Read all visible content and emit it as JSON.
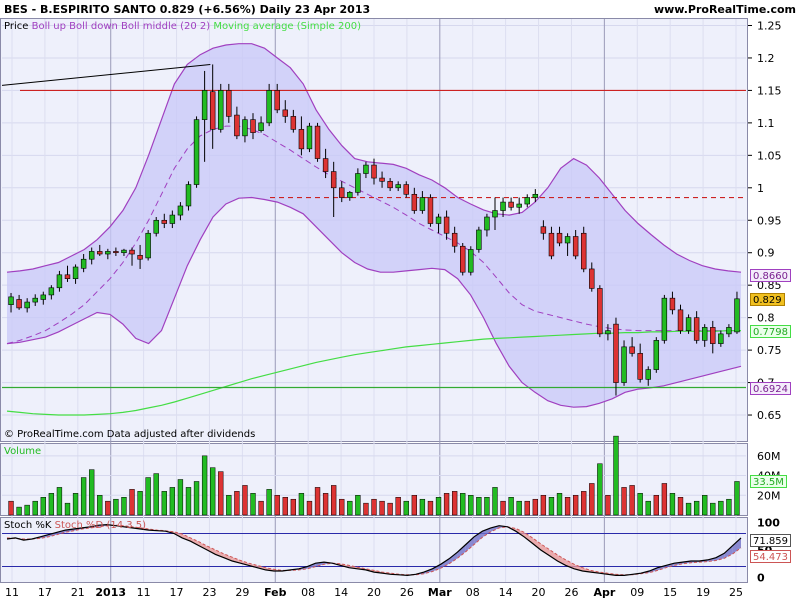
{
  "header": {
    "symbol_line": "BES - B.ESPIRITO SANTO    0.829 (+6.56%)    Daily  23 Apr 2013",
    "site": "www.ProRealTime.com"
  },
  "legends": {
    "price_prefix": "Price",
    "boll": "Boll up Boll down Boll middle (20 2)",
    "ma": "Moving average (Simple 200)",
    "copyright": "© ProRealTime.com  Data adjusted after dividends",
    "volume": "Volume",
    "stoch_k": "Stoch %K",
    "stoch_d": "Stoch %D (14 3 5)"
  },
  "colors": {
    "up": "#22bb22",
    "down": "#dd3333",
    "band_fill": "#c8c8f8",
    "band_line": "#a040c0",
    "ma200": "#44dd44",
    "resistance": "#cc2222",
    "support": "#33aa33"
  },
  "chart_data": [
    {
      "type": "candlestick",
      "title": "BES - B.ESPIRITO SANTO",
      "ylim": [
        0.61,
        1.26
      ],
      "y_ticks": [
        "0.65",
        "0.7",
        "0.75",
        "0.8",
        "0.85",
        "0.9",
        "0.95",
        "1",
        "1.05",
        "1.1",
        "1.15",
        "1.2",
        "1.25"
      ],
      "x_tick_labels": [
        "11",
        "17",
        "21",
        "2013",
        "11",
        "17",
        "23",
        "29",
        "Feb",
        "08",
        "14",
        "20",
        "26",
        "Mar",
        "08",
        "14",
        "20",
        "26",
        "Apr",
        "09",
        "15",
        "19",
        "25"
      ],
      "ohlc": [
        [
          0.82,
          0.838,
          0.808,
          0.832
        ],
        [
          0.828,
          0.835,
          0.812,
          0.815
        ],
        [
          0.815,
          0.83,
          0.808,
          0.824
        ],
        [
          0.824,
          0.836,
          0.818,
          0.83
        ],
        [
          0.828,
          0.84,
          0.82,
          0.835
        ],
        [
          0.835,
          0.85,
          0.828,
          0.846
        ],
        [
          0.846,
          0.872,
          0.84,
          0.866
        ],
        [
          0.866,
          0.88,
          0.855,
          0.86
        ],
        [
          0.86,
          0.882,
          0.852,
          0.878
        ],
        [
          0.876,
          0.898,
          0.87,
          0.89
        ],
        [
          0.89,
          0.908,
          0.882,
          0.902
        ],
        [
          0.902,
          0.912,
          0.895,
          0.898
        ],
        [
          0.898,
          0.906,
          0.89,
          0.902
        ],
        [
          0.902,
          0.908,
          0.895,
          0.9
        ],
        [
          0.9,
          0.906,
          0.895,
          0.904
        ],
        [
          0.904,
          0.908,
          0.88,
          0.898
        ],
        [
          0.896,
          0.912,
          0.875,
          0.89
        ],
        [
          0.892,
          0.935,
          0.888,
          0.93
        ],
        [
          0.93,
          0.955,
          0.925,
          0.95
        ],
        [
          0.95,
          0.96,
          0.938,
          0.945
        ],
        [
          0.945,
          0.965,
          0.938,
          0.958
        ],
        [
          0.958,
          0.978,
          0.95,
          0.972
        ],
        [
          0.972,
          1.01,
          0.965,
          1.005
        ],
        [
          1.005,
          1.11,
          1.0,
          1.105
        ],
        [
          1.105,
          1.18,
          1.04,
          1.15
        ],
        [
          1.148,
          1.19,
          1.06,
          1.09
        ],
        [
          1.09,
          1.16,
          1.085,
          1.15
        ],
        [
          1.15,
          1.16,
          1.1,
          1.11
        ],
        [
          1.112,
          1.125,
          1.075,
          1.08
        ],
        [
          1.08,
          1.11,
          1.07,
          1.105
        ],
        [
          1.105,
          1.115,
          1.075,
          1.085
        ],
        [
          1.088,
          1.11,
          1.085,
          1.1
        ],
        [
          1.1,
          1.16,
          1.095,
          1.15
        ],
        [
          1.15,
          1.16,
          1.115,
          1.12
        ],
        [
          1.12,
          1.135,
          1.1,
          1.11
        ],
        [
          1.11,
          1.12,
          1.085,
          1.09
        ],
        [
          1.09,
          1.11,
          1.05,
          1.06
        ],
        [
          1.06,
          1.1,
          1.055,
          1.095
        ],
        [
          1.095,
          1.1,
          1.04,
          1.045
        ],
        [
          1.045,
          1.06,
          1.015,
          1.025
        ],
        [
          1.025,
          1.04,
          0.955,
          1.0
        ],
        [
          1.0,
          1.01,
          0.978,
          0.985
        ],
        [
          0.985,
          0.995,
          0.98,
          0.993
        ],
        [
          0.993,
          1.03,
          0.988,
          1.022
        ],
        [
          1.022,
          1.04,
          1.015,
          1.035
        ],
        [
          1.035,
          1.045,
          1.005,
          1.015
        ],
        [
          1.015,
          1.025,
          1.0,
          1.01
        ],
        [
          1.01,
          1.015,
          0.995,
          1.0
        ],
        [
          1.0,
          1.01,
          0.995,
          1.005
        ],
        [
          1.005,
          1.01,
          0.985,
          0.99
        ],
        [
          0.99,
          1.0,
          0.96,
          0.965
        ],
        [
          0.965,
          0.995,
          0.96,
          0.985
        ],
        [
          0.985,
          0.99,
          0.94,
          0.945
        ],
        [
          0.945,
          0.96,
          0.93,
          0.955
        ],
        [
          0.955,
          0.965,
          0.92,
          0.93
        ],
        [
          0.93,
          0.94,
          0.9,
          0.91
        ],
        [
          0.91,
          0.915,
          0.865,
          0.87
        ],
        [
          0.87,
          0.91,
          0.865,
          0.905
        ],
        [
          0.905,
          0.94,
          0.9,
          0.935
        ],
        [
          0.935,
          0.96,
          0.925,
          0.955
        ],
        [
          0.955,
          0.985,
          0.935,
          0.965
        ],
        [
          0.965,
          0.985,
          0.955,
          0.978
        ],
        [
          0.978,
          0.985,
          0.965,
          0.97
        ],
        [
          0.97,
          0.985,
          0.96,
          0.975
        ],
        [
          0.975,
          0.99,
          0.97,
          0.985
        ],
        [
          0.985,
          0.998,
          0.978,
          0.99
        ],
        [
          0.94,
          0.95,
          0.92,
          0.93
        ],
        [
          0.93,
          0.94,
          0.89,
          0.895
        ],
        [
          0.93,
          0.94,
          0.91,
          0.915
        ],
        [
          0.915,
          0.93,
          0.895,
          0.925
        ],
        [
          0.925,
          0.935,
          0.89,
          0.895
        ],
        [
          0.93,
          0.94,
          0.87,
          0.875
        ],
        [
          0.875,
          0.885,
          0.84,
          0.845
        ],
        [
          0.845,
          0.85,
          0.77,
          0.775
        ],
        [
          0.775,
          0.79,
          0.765,
          0.78
        ],
        [
          0.79,
          0.8,
          0.68,
          0.7
        ],
        [
          0.7,
          0.765,
          0.695,
          0.755
        ],
        [
          0.755,
          0.77,
          0.74,
          0.745
        ],
        [
          0.745,
          0.76,
          0.7,
          0.705
        ],
        [
          0.705,
          0.725,
          0.695,
          0.72
        ],
        [
          0.72,
          0.77,
          0.715,
          0.765
        ],
        [
          0.765,
          0.835,
          0.76,
          0.83
        ],
        [
          0.83,
          0.84,
          0.805,
          0.812
        ],
        [
          0.812,
          0.82,
          0.775,
          0.78
        ],
        [
          0.78,
          0.805,
          0.775,
          0.8
        ],
        [
          0.8,
          0.81,
          0.76,
          0.765
        ],
        [
          0.765,
          0.79,
          0.755,
          0.785
        ],
        [
          0.785,
          0.795,
          0.745,
          0.76
        ],
        [
          0.76,
          0.78,
          0.755,
          0.775
        ],
        [
          0.775,
          0.79,
          0.77,
          0.785
        ],
        [
          0.778,
          0.84,
          0.775,
          0.829
        ]
      ],
      "bollinger_upper": [
        0.87,
        0.872,
        0.875,
        0.88,
        0.885,
        0.895,
        0.905,
        0.92,
        0.94,
        0.965,
        1.0,
        1.05,
        1.105,
        1.16,
        1.19,
        1.205,
        1.215,
        1.22,
        1.222,
        1.222,
        1.215,
        1.2,
        1.185,
        1.16,
        1.12,
        1.09,
        1.065,
        1.045,
        1.04,
        1.038,
        1.036,
        1.03,
        1.02,
        1.012,
        1.0,
        0.985,
        0.975,
        0.966,
        0.96,
        0.958,
        0.962,
        0.978,
        1.0,
        1.03,
        1.045,
        1.035,
        1.015,
        0.99,
        0.965,
        0.945,
        0.928,
        0.912,
        0.898,
        0.888,
        0.88,
        0.875,
        0.872,
        0.87
      ],
      "bollinger_lower": [
        0.76,
        0.762,
        0.766,
        0.77,
        0.778,
        0.788,
        0.798,
        0.808,
        0.805,
        0.79,
        0.768,
        0.76,
        0.78,
        0.83,
        0.88,
        0.92,
        0.955,
        0.975,
        0.984,
        0.985,
        0.982,
        0.978,
        0.97,
        0.96,
        0.94,
        0.92,
        0.9,
        0.885,
        0.875,
        0.87,
        0.87,
        0.872,
        0.874,
        0.876,
        0.874,
        0.86,
        0.835,
        0.8,
        0.76,
        0.725,
        0.7,
        0.685,
        0.672,
        0.665,
        0.662,
        0.663,
        0.668,
        0.675,
        0.685,
        0.69,
        0.692,
        0.695,
        0.7,
        0.705,
        0.71,
        0.715,
        0.72,
        0.725
      ],
      "bollinger_middle": [
        0.76,
        0.765,
        0.772,
        0.78,
        0.792,
        0.805,
        0.82,
        0.84,
        0.86,
        0.885,
        0.915,
        0.95,
        0.99,
        1.03,
        1.06,
        1.08,
        1.09,
        1.095,
        1.095,
        1.09,
        1.082,
        1.07,
        1.058,
        1.045,
        1.032,
        1.02,
        1.01,
        1.0,
        0.99,
        0.98,
        0.97,
        0.958,
        0.945,
        0.935,
        0.925,
        0.915,
        0.902,
        0.885,
        0.862,
        0.838,
        0.82,
        0.81,
        0.805,
        0.8,
        0.795,
        0.79,
        0.786,
        0.783,
        0.781,
        0.78,
        0.78,
        0.78,
        0.78,
        0.78,
        0.78,
        0.78,
        0.78,
        0.78
      ],
      "ma200": [
        0.656,
        0.654,
        0.652,
        0.651,
        0.65,
        0.65,
        0.65,
        0.651,
        0.652,
        0.654,
        0.657,
        0.661,
        0.665,
        0.67,
        0.676,
        0.682,
        0.688,
        0.694,
        0.7,
        0.706,
        0.711,
        0.716,
        0.721,
        0.726,
        0.731,
        0.735,
        0.739,
        0.743,
        0.746,
        0.749,
        0.752,
        0.755,
        0.757,
        0.759,
        0.761,
        0.763,
        0.765,
        0.767,
        0.768,
        0.769,
        0.77,
        0.771,
        0.772,
        0.773,
        0.774,
        0.775,
        0.776,
        0.776,
        0.777,
        0.777,
        0.778,
        0.778,
        0.779,
        0.779,
        0.779,
        0.779,
        0.78,
        0.78
      ],
      "hlines": [
        {
          "value": 1.15,
          "style": "solid",
          "color": "#cc2222"
        },
        {
          "value": 0.985,
          "style": "dashed",
          "color": "#cc2222"
        },
        {
          "value": 0.6924,
          "style": "solid",
          "color": "#33aa33"
        }
      ],
      "trendline": {
        "from": [
          0.0,
          1.17
        ],
        "to": [
          0.28,
          1.19
        ]
      },
      "value_tags": [
        {
          "value": 0.866,
          "label": "0.8660",
          "kind": "band"
        },
        {
          "value": 0.829,
          "label": "0.829",
          "kind": "price"
        },
        {
          "value": 0.7798,
          "label": "0.7798",
          "kind": "ma"
        },
        {
          "value": 0.6924,
          "label": "0.6924",
          "kind": "band"
        }
      ]
    },
    {
      "type": "bar",
      "title": "Volume",
      "ylim": [
        0,
        72
      ],
      "y_ticks": [
        "60M",
        "40M",
        "20M"
      ],
      "values": [
        14,
        8,
        10,
        14,
        18,
        22,
        28,
        12,
        22,
        38,
        46,
        20,
        14,
        16,
        18,
        26,
        24,
        38,
        42,
        24,
        28,
        36,
        28,
        34,
        60,
        48,
        44,
        20,
        24,
        30,
        22,
        14,
        26,
        20,
        18,
        16,
        22,
        14,
        28,
        22,
        30,
        16,
        14,
        20,
        12,
        16,
        14,
        12,
        18,
        14,
        20,
        16,
        14,
        18,
        22,
        24,
        22,
        20,
        18,
        18,
        28,
        14,
        18,
        14,
        14,
        16,
        20,
        18,
        22,
        18,
        20,
        24,
        32,
        52,
        20,
        80,
        28,
        30,
        22,
        14,
        20,
        32,
        22,
        18,
        12,
        14,
        20,
        12,
        14,
        16,
        34
      ],
      "directions": "rgggggggggggrggrggggggggggrgrrgrgrrrgrrrrrggrrrrrgrgrgrrgggggrggrrrggrrrrgrgrrggrrgrgggg",
      "last_tag": "33.5M"
    },
    {
      "type": "line",
      "title": "Stoch %K",
      "ylim": [
        -8,
        108
      ],
      "y_ticks": [
        "100",
        "50",
        "0"
      ],
      "k": [
        70,
        72,
        68,
        70,
        74,
        78,
        82,
        86,
        88,
        90,
        92,
        95,
        96,
        94,
        92,
        90,
        88,
        86,
        85,
        84,
        80,
        72,
        66,
        58,
        50,
        42,
        36,
        30,
        26,
        22,
        18,
        14,
        12,
        12,
        14,
        16,
        20,
        26,
        28,
        26,
        22,
        18,
        16,
        14,
        10,
        8,
        6,
        5,
        4,
        6,
        10,
        16,
        24,
        34,
        46,
        60,
        74,
        84,
        90,
        94,
        92,
        84,
        74,
        62,
        50,
        40,
        30,
        22,
        16,
        12,
        10,
        8,
        6,
        4,
        4,
        6,
        8,
        12,
        18,
        22,
        26,
        28,
        30,
        30,
        32,
        36,
        44,
        58,
        72
      ],
      "d": [
        72,
        71,
        70,
        70,
        71,
        74,
        78,
        82,
        85,
        88,
        90,
        92,
        94,
        95,
        94,
        92,
        90,
        88,
        86,
        85,
        83,
        79,
        72,
        65,
        57,
        50,
        43,
        37,
        31,
        26,
        22,
        18,
        15,
        13,
        13,
        14,
        16,
        20,
        24,
        26,
        25,
        22,
        19,
        16,
        13,
        10,
        8,
        6,
        5,
        5,
        7,
        11,
        17,
        25,
        35,
        47,
        60,
        73,
        83,
        90,
        92,
        89,
        82,
        72,
        61,
        51,
        41,
        32,
        24,
        18,
        13,
        10,
        8,
        6,
        5,
        5,
        7,
        9,
        13,
        18,
        22,
        25,
        27,
        28,
        29,
        31,
        35,
        43,
        54
      ],
      "last_k_tag": "71.859",
      "last_d_tag": "54.473",
      "levels": [
        80,
        20
      ]
    }
  ]
}
